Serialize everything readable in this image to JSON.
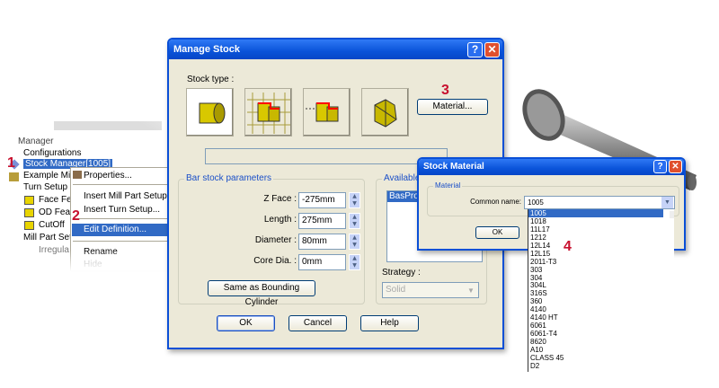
{
  "tree": {
    "header": "Manager",
    "items": [
      "Configurations",
      "Stock Manager[1005]",
      "Example Mi",
      "Turn Setup",
      "Face Fe",
      "OD Fea",
      "CutOff",
      "Mill Part Set",
      "Irregula"
    ]
  },
  "context_menu": {
    "items": [
      "Properties...",
      "Insert Mill Part Setup...",
      "Insert Turn Setup...",
      "Edit Definition...",
      "Rename",
      "Hide"
    ],
    "selected": "Edit Definition..."
  },
  "steps": [
    "1",
    "2",
    "3",
    "4"
  ],
  "manage_stock": {
    "title": "Manage Stock",
    "stock_type_label": "Stock type :",
    "stock_types": [
      "cylinder-stock-icon",
      "grid-profile-stock-icon",
      "profile-stock-icon",
      "stl-mesh-stock-icon"
    ],
    "material_button": "Material...",
    "bar_stock_group": "Bar stock parameters",
    "fields": [
      {
        "label": "Z Face :",
        "value": "-275mm"
      },
      {
        "label": "Length :",
        "value": "275mm"
      },
      {
        "label": "Diameter :",
        "value": "80mm"
      },
      {
        "label": "Core Dia. :",
        "value": "0mm"
      }
    ],
    "same_as_button": "Same as Bounding Cylinder",
    "available_group": "Available",
    "available_items": [
      "BasPro"
    ],
    "strategy_label": "Strategy :",
    "strategy_value": "Solid",
    "ok": "OK",
    "cancel": "Cancel",
    "help": "Help"
  },
  "stock_material": {
    "title": "Stock Material",
    "group": "Material",
    "common_name_label": "Common name:",
    "common_name_value": "1005",
    "ok": "OK",
    "options": [
      "1005",
      "1018",
      "11L17",
      "1212",
      "12L14",
      "12L15",
      "2011-T3",
      "303",
      "304",
      "304L",
      "316S",
      "360",
      "4140",
      "4140 HT",
      "6061",
      "6061-T4",
      "8620",
      "A10",
      "CLASS 45",
      "D2"
    ]
  },
  "colors": {
    "titlebar": "#0a53d9",
    "selection": "#316ac5",
    "step": "#c8102e",
    "dialog": "#ece9d8"
  }
}
